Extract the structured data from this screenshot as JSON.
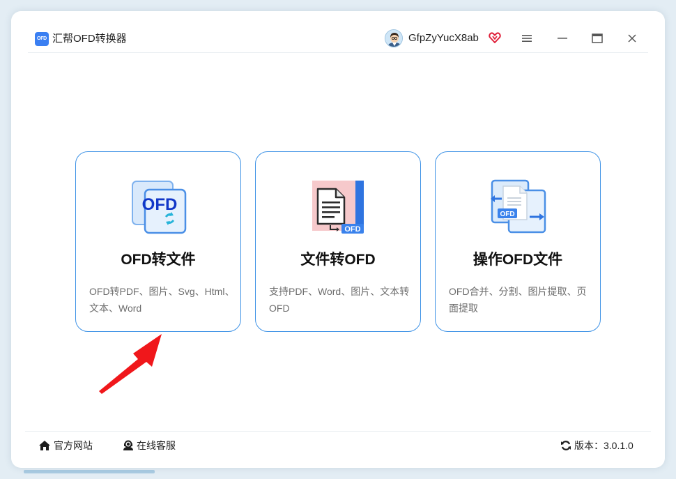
{
  "window": {
    "app_logo_text": "OFD",
    "app_title": "汇帮OFD转换器",
    "user_name": "GfpZyYucX8ab",
    "accent_color": "#3f93e6",
    "icons": [
      "vip-heart-icon",
      "menu-icon",
      "minimize-icon",
      "maximize-icon",
      "close-icon"
    ]
  },
  "cards": [
    {
      "title": "OFD转文件",
      "icon_label": "OFD",
      "description": "OFD转PDF、图片、Svg、Html、文本、Word"
    },
    {
      "title": "文件转OFD",
      "icon_label": "OFD",
      "description": "支持PDF、Word、图片、文本转OFD"
    },
    {
      "title": "操作OFD文件",
      "icon_label": "OFD",
      "description": "OFD合并、分割、图片提取、页面提取"
    }
  ],
  "footer": {
    "official_site": "官方网站",
    "online_service": "在线客服",
    "version": "版本：3.0.1.0"
  }
}
